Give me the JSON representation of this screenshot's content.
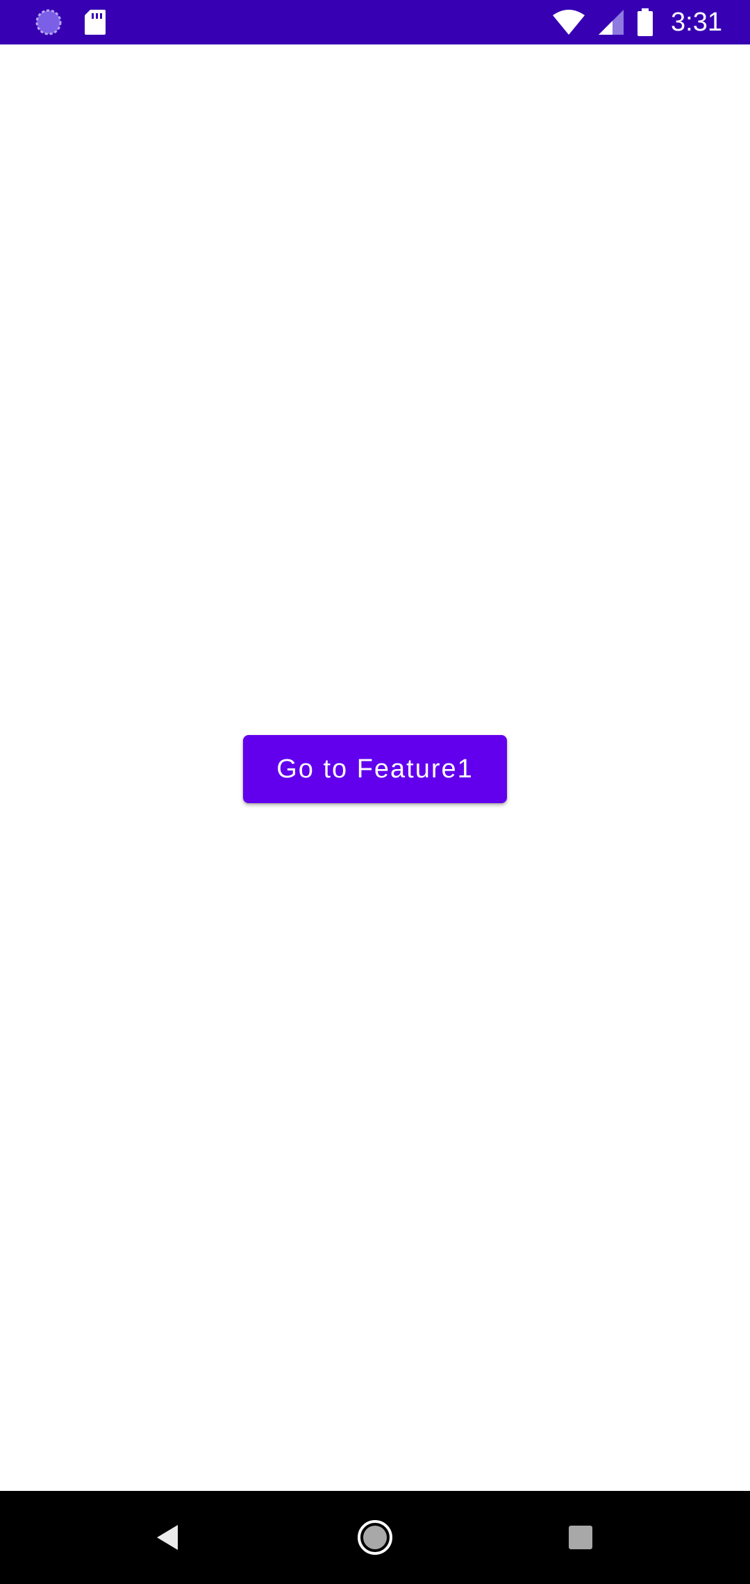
{
  "status_bar": {
    "time": "3:31",
    "background_color": "#3700b3",
    "left_icons": [
      "loading-circle-icon",
      "sd-card-icon"
    ],
    "right_icons": [
      "wifi-icon",
      "cellular-signal-icon",
      "battery-icon"
    ]
  },
  "main": {
    "button_label": "Go to Feature1",
    "button_color": "#6200ee"
  },
  "navigation_bar": {
    "buttons": [
      "back-icon",
      "home-icon",
      "recents-icon"
    ]
  }
}
